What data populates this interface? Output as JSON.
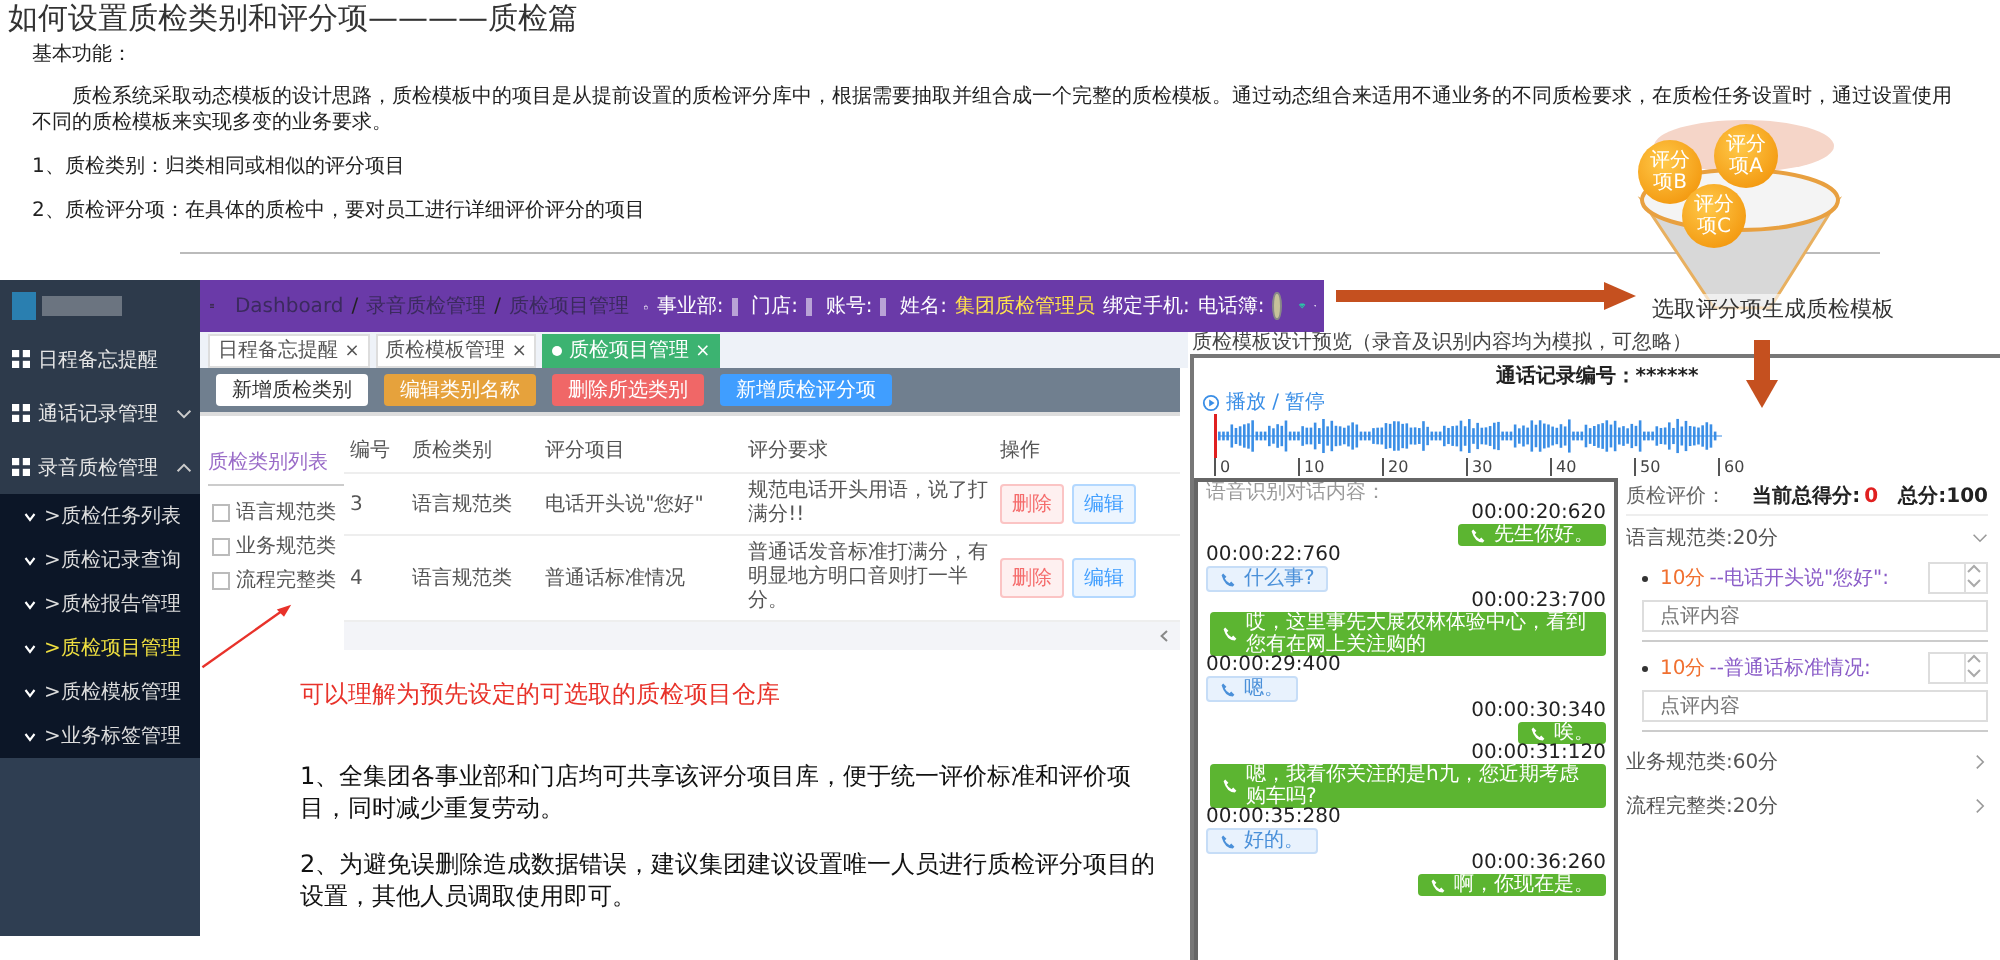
{
  "title": "如何设置质检类别和评分项————质检篇",
  "intro": {
    "heading": "基本功能：",
    "paragraph": "质检系统采取动态模板的设计思路，质检模板中的项目是从提前设置的质检评分库中，根据需要抽取并组合成一个完整的质检模板。通过动态组合来适用不通业务的不同质检要求，在质检任务设置时，通过设置使用不同的质检模板来实现多变的业务要求。",
    "points": [
      "1、质检类别：归类相同或相似的评分项目",
      "2、质检评分项：在具体的质检中，要对员工进行详细评价评分的项目"
    ]
  },
  "admin_screen": {
    "breadcrumb": [
      "Dashboard",
      "/",
      "录音质检管理",
      "/",
      "质检项目管理"
    ],
    "user_info": [
      {
        "label": "事业部:",
        "redacted": true
      },
      {
        "label": "门店:",
        "redacted": true
      },
      {
        "label": "账号:",
        "redacted": true
      },
      {
        "label": "姓名:",
        "value": "集团质检管理员"
      },
      {
        "label": "绑定手机:"
      },
      {
        "label": "电话簿:"
      }
    ],
    "sidebar": [
      {
        "label": "日程备忘提醒"
      },
      {
        "label": "通话记录管理",
        "expanded": false
      },
      {
        "label": "录音质检管理",
        "expanded": true,
        "children": [
          {
            "label": ">质检任务列表",
            "selected": false
          },
          {
            "label": ">质检记录查询",
            "selected": false
          },
          {
            "label": ">质检报告管理",
            "selected": false
          },
          {
            "label": ">质检项目管理",
            "selected": true
          },
          {
            "label": ">质检模板管理",
            "selected": false
          },
          {
            "label": ">业务标签管理",
            "selected": false
          }
        ]
      }
    ],
    "tabs": [
      {
        "label": "日程备忘提醒",
        "close": "×",
        "selected": false
      },
      {
        "label": "质检模板管理",
        "close": "×",
        "selected": false
      },
      {
        "label": "质检项目管理",
        "close": "×",
        "selected": true
      }
    ],
    "toolbar": [
      {
        "label": "新增质检类别",
        "kind": "default"
      },
      {
        "label": "编辑类别名称",
        "kind": "warning"
      },
      {
        "label": "删除所选类别",
        "kind": "danger"
      },
      {
        "label": "新增质检评分项",
        "kind": "primary"
      }
    ],
    "category_list": {
      "title": "质检类别列表",
      "items": [
        {
          "label": "语言规范类",
          "checked": false
        },
        {
          "label": "业务规范类",
          "checked": false
        },
        {
          "label": "流程完整类",
          "checked": false
        }
      ]
    },
    "table": {
      "columns": [
        "编号",
        "质检类别",
        "评分项目",
        "评分要求",
        "操作"
      ],
      "rows": [
        {
          "id": "3",
          "category": "语言规范类",
          "item": "电话开头说\"您好\"",
          "requirement": "规范电话开头用语，说了打满分!!",
          "actions": [
            "删除",
            "编辑"
          ]
        },
        {
          "id": "4",
          "category": "语言规范类",
          "item": "普通话标准情况",
          "requirement": "普通话发音标准打满分，有明显地方明口音则打一半分。",
          "actions": [
            "删除",
            "编辑"
          ]
        }
      ]
    }
  },
  "annotation": "可以理解为预先设定的可选取的质检项目仓库",
  "notes": [
    "1、全集团各事业部和门店均可共享该评分项目库，便于统一评价标准和评价项目，同时减少重复劳动。",
    "2、为避免误删除造成数据错误，建议集团建议设置唯一人员进行质检评分项目的设置，其他人员调取使用即可。"
  ],
  "funnel": {
    "coins": [
      "评分项A",
      "评分项B",
      "评分项C"
    ],
    "caption": "选取评分项生成质检模板"
  },
  "preview": {
    "title": "质检模板设计预览（录音及识别内容均为模拟，可忽略）",
    "record_label": "通话记录编号：******",
    "player": "播放 / 暂停",
    "ticks": [
      "0",
      "10",
      "20",
      "30",
      "40",
      "50",
      "60"
    ],
    "chat_label": "语音识别对话内容：",
    "messages": [
      {
        "time": "00:00:20:620",
        "text": "先生你好。",
        "kind": "agent"
      },
      {
        "time": "00:00:22:760",
        "text": "什么事?",
        "kind": "customer"
      },
      {
        "time": "00:00:23:700",
        "text": "哎，这里事先大展农林体验中心，看到您有在网上关注购的",
        "kind": "agent"
      },
      {
        "time": "00:00:29:400",
        "text": "嗯。",
        "kind": "customer"
      },
      {
        "time": "00:00:30:340",
        "text": "唉。",
        "kind": "agent"
      },
      {
        "time": "00:00:31:120",
        "text": "嗯，我看你关注的是h九，您近期考虑购车吗?",
        "kind": "agent"
      },
      {
        "time": "00:00:35:280",
        "text": "好的。",
        "kind": "customer"
      },
      {
        "time": "00:00:36:260",
        "text": "啊，你现在是。",
        "kind": "agent"
      }
    ],
    "evaluation": {
      "label": "质检评价：",
      "score_label": "当前总得分:",
      "score": "0",
      "total": "总分:100",
      "groups": [
        {
          "name": "语言规范类:20分",
          "expanded": true,
          "items": [
            {
              "points": "10分",
              "name": "--电话开头说\"您好\":",
              "placeholder": "点评内容"
            },
            {
              "points": "10分",
              "name": "--普通话标准情况:",
              "placeholder": "点评内容"
            }
          ]
        },
        {
          "name": "业务规范类:60分",
          "expanded": false
        },
        {
          "name": "流程完整类:20分",
          "expanded": false
        }
      ]
    }
  }
}
